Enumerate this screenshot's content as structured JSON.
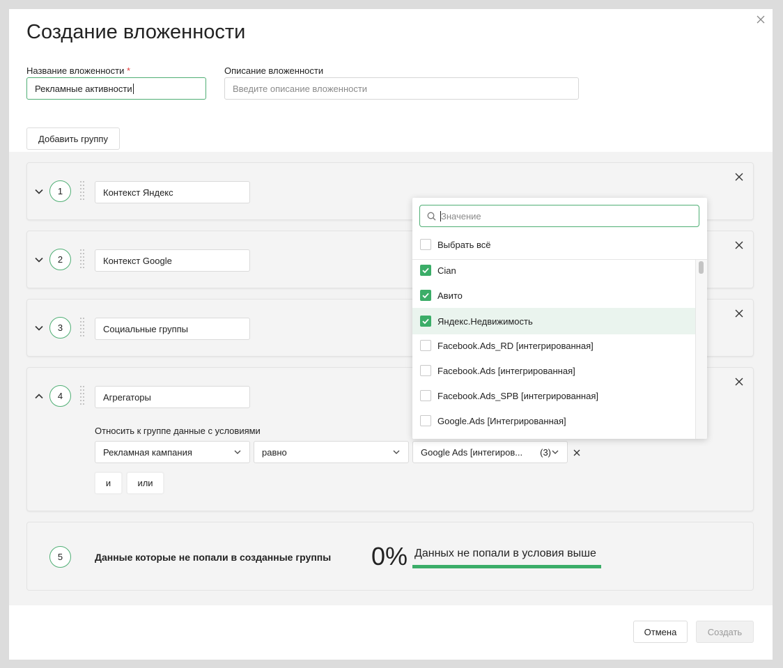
{
  "modal": {
    "title": "Создание вложенности",
    "name_label": "Название вложенности",
    "name_required_mark": "*",
    "name_value": "Рекламные активности",
    "desc_label": "Описание вложенности",
    "desc_placeholder": "Введите описание вложенности",
    "add_group_label": "Добавить группу"
  },
  "groups": [
    {
      "number": "1",
      "name": "Контекст Яндекс"
    },
    {
      "number": "2",
      "name": "Контекст Google"
    },
    {
      "number": "3",
      "name": "Социальные группы"
    },
    {
      "number": "4",
      "name": "Агрегаторы"
    }
  ],
  "condition": {
    "label": "Относить к группе данные с условиями",
    "field": "Рекламная кампания",
    "operator": "равно",
    "value": "Google Ads [интегиров...",
    "count": "(3)",
    "and_label": "и",
    "or_label": "или"
  },
  "dropdown": {
    "search_placeholder": "Значение",
    "select_all": "Выбрать всё",
    "items": [
      {
        "label": "Cian",
        "checked": true
      },
      {
        "label": "Авито",
        "checked": true
      },
      {
        "label": "Яндекс.Недвижимость",
        "checked": true
      },
      {
        "label": "Facebook.Ads_RD [интегрированная]",
        "checked": false
      },
      {
        "label": "Facebook.Ads [интегрированная]",
        "checked": false
      },
      {
        "label": "Facebook.Ads_SPB [интегрированная]",
        "checked": false
      },
      {
        "label": "Google.Ads [Интегрированная]",
        "checked": false
      }
    ]
  },
  "remainder": {
    "number": "5",
    "text": "Данные которые не попали в созданные группы",
    "percent": "0%",
    "note": "Данных не попали в условия выше"
  },
  "footer": {
    "cancel_label": "Отмена",
    "create_label": "Создать"
  },
  "colors": {
    "accent": "#3bad68",
    "required": "#e23b3b"
  }
}
